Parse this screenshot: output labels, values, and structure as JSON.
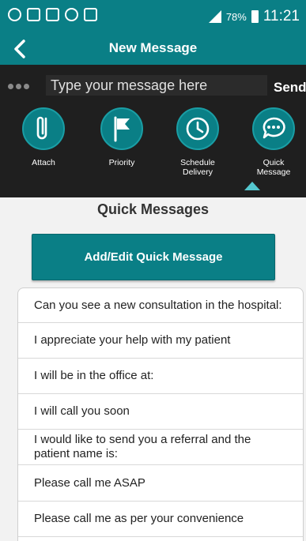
{
  "status_bar": {
    "battery": "78%",
    "time": "11:21"
  },
  "header": {
    "title": "New Message"
  },
  "compose": {
    "placeholder": "Type your message here",
    "send_label": "Send"
  },
  "actions": [
    {
      "label": "Attach",
      "icon": "paperclip-icon"
    },
    {
      "label": "Priority",
      "icon": "flag-icon"
    },
    {
      "label": "Schedule\nDelivery",
      "icon": "clock-icon"
    },
    {
      "label": "Quick\nMessage",
      "icon": "chat-bubble-icon"
    }
  ],
  "quick_messages": {
    "title": "Quick Messages",
    "add_label": "Add/Edit Quick Message",
    "items": [
      "Can you see a new consultation in the hospital:",
      "I appreciate your help with my patient",
      "I will be in the office at:",
      "I will call you soon",
      "I would like to send you a referral and the patient name is:",
      "Please call me ASAP",
      "Please call me as per your convenience"
    ]
  },
  "colors": {
    "primary": "#0a7f86",
    "toolbar_bg": "#1f1f1f",
    "indicator": "#54c7cf"
  }
}
